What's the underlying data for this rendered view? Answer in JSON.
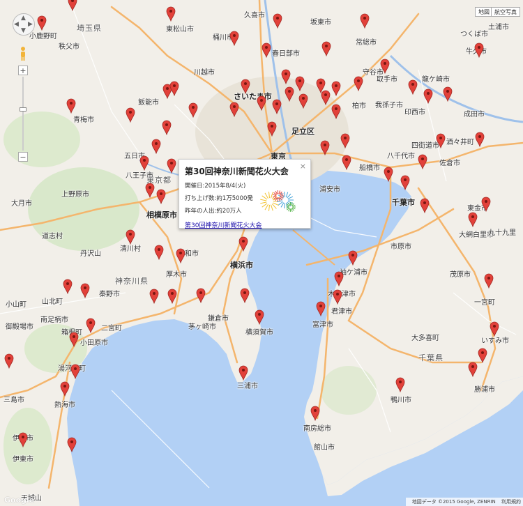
{
  "map": {
    "logo": "Google",
    "map_type_buttons": [
      "地図",
      "航空写真"
    ],
    "attribution": "地図データ ©2015 Google, ZENRIN",
    "terms": "利用規約",
    "zoom_in": "+",
    "zoom_out": "−",
    "pan_arrows": {
      "up": "▲",
      "down": "▼",
      "left": "◀",
      "right": "▶"
    },
    "colors": {
      "land": "#f2efe9",
      "water": "#b2d0f5",
      "marker": "#e2413a",
      "road_major": "#f4b56c",
      "road_minor": "#ffffff",
      "park": "#cfe6bd"
    }
  },
  "popup": {
    "title": "第30回神奈川新聞花火大会",
    "date": "開催日:2015年8/4(火)",
    "launches": "打ち上げ数:約1万5000発",
    "attendance": "昨年の人出:約20万人",
    "link": "第30回神奈川新聞花火大会",
    "close": "×",
    "icon": "fireworks-icon"
  },
  "labels": [
    {
      "text": "埼玉県",
      "cls": "pref"
    },
    {
      "text": "東京都",
      "cls": "pref"
    },
    {
      "text": "千葉県",
      "cls": "pref"
    },
    {
      "text": "神奈川県",
      "cls": "pref"
    },
    {
      "text": "さいたま市",
      "cls": "big"
    },
    {
      "text": "足立区",
      "cls": "big"
    },
    {
      "text": "東京",
      "cls": "big"
    },
    {
      "text": "千葉市",
      "cls": "big"
    },
    {
      "text": "横浜市",
      "cls": "big"
    },
    {
      "text": "相模原市",
      "cls": "big"
    },
    {
      "text": "小鹿野町",
      "cls": ""
    },
    {
      "text": "秩父市",
      "cls": ""
    },
    {
      "text": "東松山市",
      "cls": ""
    },
    {
      "text": "久喜市",
      "cls": ""
    },
    {
      "text": "坂東市",
      "cls": ""
    },
    {
      "text": "土浦市",
      "cls": ""
    },
    {
      "text": "常総市",
      "cls": ""
    },
    {
      "text": "つくば市",
      "cls": ""
    },
    {
      "text": "牛久市",
      "cls": ""
    },
    {
      "text": "桶川市",
      "cls": ""
    },
    {
      "text": "春日部市",
      "cls": ""
    },
    {
      "text": "川越市",
      "cls": ""
    },
    {
      "text": "飯能市",
      "cls": ""
    },
    {
      "text": "青梅市",
      "cls": ""
    },
    {
      "text": "柏市",
      "cls": ""
    },
    {
      "text": "我孫子市",
      "cls": ""
    },
    {
      "text": "印西市",
      "cls": ""
    },
    {
      "text": "成田市",
      "cls": ""
    },
    {
      "text": "八王子市",
      "cls": ""
    },
    {
      "text": "五日市",
      "cls": ""
    },
    {
      "text": "八千代市",
      "cls": ""
    },
    {
      "text": "佐倉市",
      "cls": ""
    },
    {
      "text": "浦安市",
      "cls": ""
    },
    {
      "text": "船橋市",
      "cls": ""
    },
    {
      "text": "市原市",
      "cls": ""
    },
    {
      "text": "大和市",
      "cls": ""
    },
    {
      "text": "厚木市",
      "cls": ""
    },
    {
      "text": "袖ケ浦市",
      "cls": ""
    },
    {
      "text": "木更津市",
      "cls": ""
    },
    {
      "text": "君津市",
      "cls": ""
    },
    {
      "text": "富津市",
      "cls": ""
    },
    {
      "text": "横須賀市",
      "cls": ""
    },
    {
      "text": "鎌倉市",
      "cls": ""
    },
    {
      "text": "茅ヶ崎市",
      "cls": ""
    },
    {
      "text": "秦野市",
      "cls": ""
    },
    {
      "text": "小田原市",
      "cls": ""
    },
    {
      "text": "南足柄市",
      "cls": ""
    },
    {
      "text": "箱根町",
      "cls": ""
    },
    {
      "text": "湯河原町",
      "cls": ""
    },
    {
      "text": "熱海市",
      "cls": ""
    },
    {
      "text": "伊東市",
      "cls": ""
    },
    {
      "text": "三浦市",
      "cls": ""
    },
    {
      "text": "鴨川市",
      "cls": ""
    },
    {
      "text": "勝浦市",
      "cls": ""
    },
    {
      "text": "いすみ市",
      "cls": ""
    },
    {
      "text": "南房総市",
      "cls": ""
    },
    {
      "text": "館山市",
      "cls": ""
    },
    {
      "text": "大網白里市",
      "cls": ""
    },
    {
      "text": "茂原市",
      "cls": ""
    },
    {
      "text": "一宮町",
      "cls": ""
    },
    {
      "text": "大多喜町",
      "cls": ""
    },
    {
      "text": "上野原市",
      "cls": ""
    },
    {
      "text": "大月市",
      "cls": ""
    },
    {
      "text": "丹沢山",
      "cls": ""
    },
    {
      "text": "道志村",
      "cls": ""
    },
    {
      "text": "御殿場市",
      "cls": ""
    },
    {
      "text": "小山町",
      "cls": ""
    },
    {
      "text": "三島市",
      "cls": ""
    },
    {
      "text": "伊豆市",
      "cls": ""
    },
    {
      "text": "天城山",
      "cls": ""
    },
    {
      "text": "東金市",
      "cls": ""
    },
    {
      "text": "九十九里",
      "cls": ""
    },
    {
      "text": "龍ケ崎市",
      "cls": ""
    },
    {
      "text": "取手市",
      "cls": ""
    },
    {
      "text": "清川村",
      "cls": ""
    },
    {
      "text": "山北町",
      "cls": ""
    },
    {
      "text": "二宮町",
      "cls": ""
    },
    {
      "text": "四街道市",
      "cls": ""
    },
    {
      "text": "酒々井町",
      "cls": ""
    },
    {
      "text": "守谷市",
      "cls": ""
    }
  ],
  "marker_count_note": "",
  "markers": 78
}
